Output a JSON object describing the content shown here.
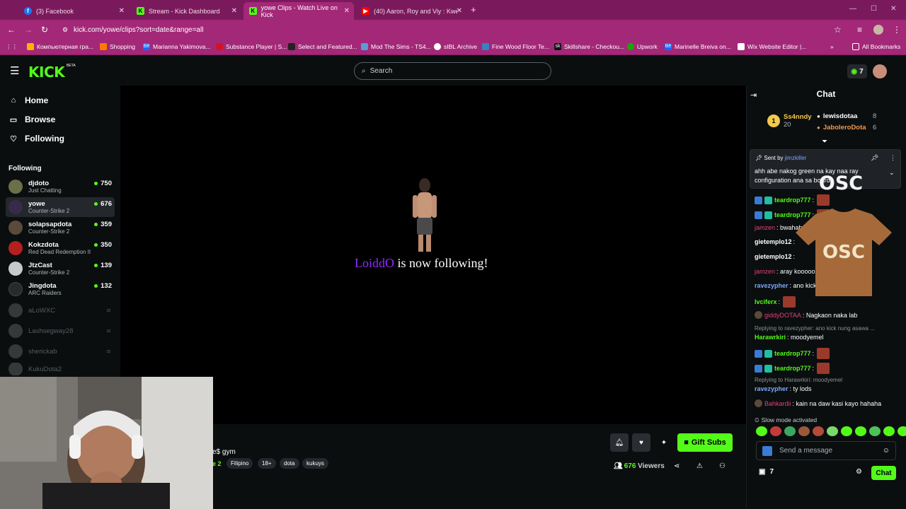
{
  "browser": {
    "tabs": [
      {
        "label": "(3) Facebook",
        "icon": "facebook-icon"
      },
      {
        "label": "Stream - Kick Dashboard",
        "icon": "kick-icon"
      },
      {
        "label": "yowe Clips - Watch Live on Kick",
        "icon": "kick-icon"
      },
      {
        "label": "(40) Aaron, Roy and Viy : Kwent",
        "icon": "youtube-icon"
      }
    ],
    "url": "kick.com/yowe/clips?sort=date&range=all",
    "bookmarks": [
      "Компьютерная гра...",
      "Shopping",
      "Marianna Yakimova...",
      "Substance Player | S...",
      "Select and Featured...",
      "Mod The Sims - TS4...",
      "sIBL Archive",
      "Fine Wood Floor Te...",
      "Skillshare - Checkou...",
      "Upwork",
      "Marinelle Breiva on...",
      "Wix Website Editor |..."
    ],
    "all_bookmarks": "All Bookmarks"
  },
  "site": {
    "logo": "KICK",
    "beta": "BETA",
    "search_placeholder": "Search",
    "points": "7"
  },
  "nav": {
    "home": "Home",
    "browse": "Browse",
    "following": "Following",
    "section": "Following"
  },
  "channels": [
    {
      "name": "djdoto",
      "game": "Just Chatting",
      "viewers": "750",
      "online": true,
      "color": "#6b6f4a"
    },
    {
      "name": "yowe",
      "game": "Counter-Strike 2",
      "viewers": "676",
      "online": true,
      "color": "#3a2a4a"
    },
    {
      "name": "solapsapdota",
      "game": "Counter-Strike 2",
      "viewers": "359",
      "online": true,
      "color": "#5a4a3a"
    },
    {
      "name": "Kokzdota",
      "game": "Red Dead Redemption II",
      "viewers": "350",
      "online": true,
      "color": "#b32020"
    },
    {
      "name": "JtzCast",
      "game": "Counter-Strike 2",
      "viewers": "139",
      "online": true,
      "color": "#c9c9c9"
    },
    {
      "name": "Jingdota",
      "game": "ARC Raiders",
      "viewers": "132",
      "online": true,
      "color": "#2a2a2a"
    },
    {
      "name": "aLoWXC",
      "online": false,
      "color": "#8a8a8a"
    },
    {
      "name": "Lashsegway28",
      "online": false,
      "color": "#8a8a8a"
    },
    {
      "name": "sherickab",
      "online": false,
      "color": "#8a8a8a"
    },
    {
      "name": "KukuDota2",
      "online": false,
      "color": "#8a8a8a"
    }
  ],
  "overlay": {
    "follower": "LoiddO",
    "text": " is now following!"
  },
  "stream": {
    "title": "e$ gym",
    "category": "e 2",
    "tags": [
      "Filipino",
      "18+",
      "dota",
      "kukuys"
    ],
    "gift_label": "Gift Subs",
    "viewers_count": "676",
    "viewers_label": " Viewers"
  },
  "chat": {
    "title": "Chat",
    "leaderboard": [
      {
        "rank": "1",
        "name": "Ss4nndy",
        "count": "20",
        "color": "#f2c94c"
      },
      {
        "name": "lewisdotaa",
        "count": "8",
        "color": "#fff"
      },
      {
        "name": "JaboleroDota",
        "count": "6",
        "color": "#f2994a"
      }
    ],
    "pinned": {
      "by_label": "Sent by ",
      "by_user": "jimzkiller",
      "text": "ahh abe nakog green na kay naa ray configuration ana sa board"
    },
    "messages": [
      {
        "user": "teardrop777",
        "color": "#53fc18",
        "text": ":",
        "emote": true
      },
      {
        "user": "teardrop777",
        "color": "#53fc18",
        "text": ":",
        "emote": true
      },
      {
        "user": "jamzen",
        "color": "#e0407a",
        "text": ": bwahahah"
      },
      {
        "user": "gietemplo12",
        "color": "#ffffff",
        "text": ":"
      },
      {
        "user": "gietemplo12",
        "color": "#ffffff",
        "text": ":"
      },
      {
        "user": "jamzen",
        "color": "#e0407a",
        "text": ": aray kooooo"
      },
      {
        "user": "ravezypher",
        "color": "#7aa6ff",
        "text": ": ano kick ... ve"
      },
      {
        "user": "lvciferx",
        "color": "#53fc18",
        "text": ":",
        "emote": true
      },
      {
        "user": "giddyDOTAA",
        "color": "#e0407a",
        "text": ": Nagkaon naka lab"
      },
      {
        "user": "Harawrkiri",
        "color": "#53fc18",
        "text": ": moodyemel"
      },
      {
        "user": "teardrop777",
        "color": "#53fc18",
        "text": ":",
        "emote": true
      },
      {
        "user": "teardrop777",
        "color": "#53fc18",
        "text": ":",
        "emote": true
      },
      {
        "user": "ravezypher",
        "color": "#7aa6ff",
        "text": ": ty lods"
      },
      {
        "user": "Bahkardii",
        "color": "#e0407a",
        "text": ": kain na daw kasi kayo hahaha"
      }
    ],
    "replies": [
      "Replying to ravezypher: ano kick nung asawa ...",
      "Replying to Harawrkiri: moodyemel"
    ],
    "merch_text": "OSC",
    "slow_mode": "Slow mode activated",
    "send_placeholder": "Send a message",
    "points": "7",
    "chat_button": "Chat"
  }
}
